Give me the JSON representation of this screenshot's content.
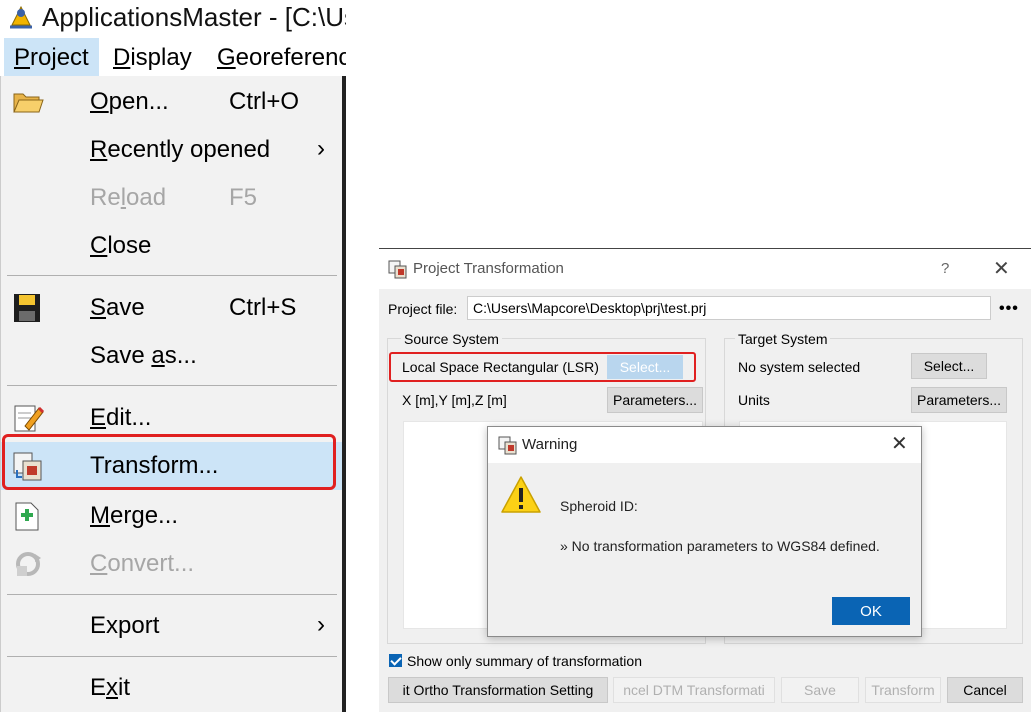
{
  "app": {
    "title": "ApplicationsMaster - [C:\\Us",
    "menubar": [
      {
        "label": "Project",
        "key": "P",
        "rest": "roject"
      },
      {
        "label": "Display",
        "key": "D",
        "rest": "isplay"
      },
      {
        "label": "Georeferenc",
        "key": "G",
        "rest": "eoreferenc"
      }
    ]
  },
  "project_menu": {
    "items": [
      {
        "key": "O",
        "rest": "pen...",
        "shortcut": "Ctrl+O",
        "icon": "folder-open-icon"
      },
      {
        "key": "R",
        "rest": "ecently opened",
        "submenu": "›"
      },
      {
        "pre": "Re",
        "key": "l",
        "rest": "oad",
        "shortcut": "F5",
        "disabled": true
      },
      {
        "key": "C",
        "rest": "lose"
      },
      {
        "key": "S",
        "rest": "ave",
        "shortcut": "Ctrl+S",
        "icon": "floppy-disk-icon"
      },
      {
        "pre": "Save ",
        "key": "a",
        "rest": "s..."
      },
      {
        "key": "E",
        "rest": "dit...",
        "icon": "edit-pencil-icon"
      },
      {
        "label": "Transform...",
        "icon": "transform-icon",
        "highlighted": true
      },
      {
        "key": "M",
        "rest": "erge...",
        "icon": "merge-icon"
      },
      {
        "key": "C",
        "rest": "onvert...",
        "icon": "convert-icon",
        "disabled": true
      },
      {
        "label": "Export",
        "submenu": "›"
      },
      {
        "pre": "E",
        "key": "x",
        "rest": "it"
      }
    ]
  },
  "transform_dialog": {
    "title": "Project Transformation",
    "help": "?",
    "close": "✕",
    "project_file_label": "Project file:",
    "project_file_value": "C:\\Users\\Mapcore\\Desktop\\prj\\test.prj",
    "browse": "•••",
    "source": {
      "group_label": "Source System",
      "system": "Local Space Rectangular (LSR)",
      "select_button": "Select...",
      "units": "X [m],Y [m],Z [m]",
      "parameters_button": "Parameters..."
    },
    "target": {
      "group_label": "Target System",
      "system": "No system selected",
      "select_button": "Select...",
      "units": "Units",
      "parameters_button": "Parameters..."
    },
    "summary_checkbox": "Show only summary of transformation",
    "summary_checked": true,
    "buttons": {
      "ortho": "it Ortho Transformation Setting",
      "dtm": "ncel DTM Transformati",
      "save": "Save",
      "transform": "Transform",
      "cancel": "Cancel"
    }
  },
  "warning_dialog": {
    "title": "Warning",
    "close": "✕",
    "icon": "warning-triangle-icon",
    "line1": "Spheroid ID:",
    "line2": "» No transformation parameters to WGS84 defined.",
    "ok": "OK"
  },
  "colors": {
    "highlight": "#cce4f7",
    "annotation_red": "#e02020",
    "primary_blue": "#0a64b4"
  }
}
